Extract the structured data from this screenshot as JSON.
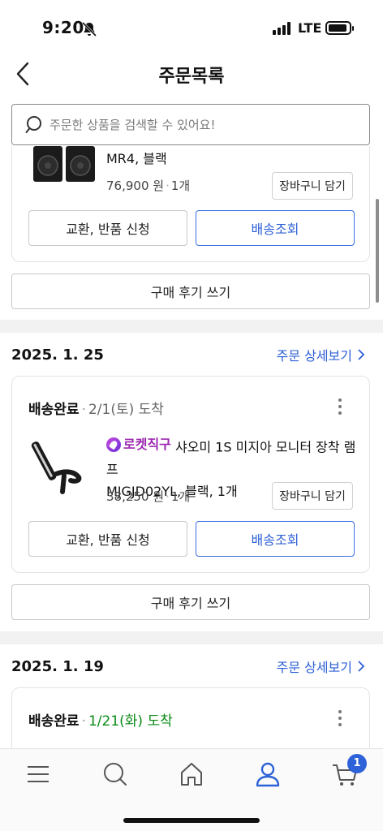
{
  "status_bar": {
    "time": "9:20",
    "network": "LTE"
  },
  "header": {
    "title": "주문목록"
  },
  "search": {
    "placeholder": "주문한 상품을 검색할 수 있어요!"
  },
  "orders": [
    {
      "product": {
        "title_line2": "MR4, 블랙",
        "price": "76,900 원",
        "qty": "1개"
      },
      "buttons": {
        "cart": "장바구니 담기",
        "exchange": "교환, 반품 신청",
        "track": "배송조회",
        "review": "구매 후기 쓰기"
      }
    },
    {
      "date": "2025. 1. 25",
      "detail_link": "주문 상세보기",
      "status": "배송완료",
      "arrival": "2/1(토) 도착",
      "product": {
        "badge": "로켓직구",
        "title_line1": "샤오미 1S 미지아 모니터 장착 램프",
        "title_line2": "MJGJD02YL, 블랙, 1개",
        "price": "38,250 원",
        "qty": "1개"
      },
      "buttons": {
        "cart": "장바구니 담기",
        "exchange": "교환, 반품 신청",
        "track": "배송조회",
        "review": "구매 후기 쓰기"
      }
    },
    {
      "date": "2025. 1. 19",
      "detail_link": "주문 상세보기",
      "status": "배송완료",
      "arrival": "1/21(화) 도착",
      "arrival_color": "#0a8a17"
    }
  ],
  "tab_bar": {
    "tabs": [
      "menu-icon",
      "search-icon",
      "home-icon",
      "my-account-icon",
      "cart-icon"
    ],
    "active": "my-account-icon",
    "cart_badge": "1",
    "accent": "#2d62d8"
  }
}
